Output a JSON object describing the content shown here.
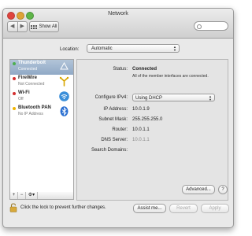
{
  "window": {
    "title": "Network"
  },
  "toolbar": {
    "back": "◀",
    "forward": "▶",
    "show_all": "Show All",
    "search_placeholder": ""
  },
  "location": {
    "label": "Location:",
    "value": "Automatic"
  },
  "services": [
    {
      "name": "Thunderbolt",
      "status": "Connected",
      "status_color": "#4caf50",
      "selected": true,
      "icon": "thunderbolt-icon"
    },
    {
      "name": "FireWire",
      "status": "Not Connected",
      "status_color": "#d32f2f",
      "icon": "firewire-icon"
    },
    {
      "name": "Wi-Fi",
      "status": "Off",
      "status_color": "#d32f2f",
      "icon": "wifi-icon"
    },
    {
      "name": "Bluetooth PAN",
      "status": "No IP Address",
      "status_color": "#f0b400",
      "icon": "bluetooth-icon"
    }
  ],
  "sidebar_buttons": {
    "add": "+",
    "remove": "−",
    "gear": "⚙▾"
  },
  "details": {
    "status_label": "Status:",
    "status_value": "Connected",
    "status_note": "All of the member interfaces are connected.",
    "configure_label": "Configure IPv4:",
    "configure_value": "Using DHCP",
    "ip_label": "IP Address:",
    "ip_value": "10.0.1.9",
    "subnet_label": "Subnet Mask:",
    "subnet_value": "255.255.255.0",
    "router_label": "Router:",
    "router_value": "10.0.1.1",
    "dns_label": "DNS Server:",
    "dns_value": "10.0.1.1",
    "search_domains_label": "Search Domains:",
    "advanced_label": "Advanced...",
    "help_label": "?"
  },
  "footer": {
    "lock_text": "Click the lock to prevent further changes.",
    "assist_label": "Assist me...",
    "revert_label": "Revert",
    "apply_label": "Apply"
  }
}
